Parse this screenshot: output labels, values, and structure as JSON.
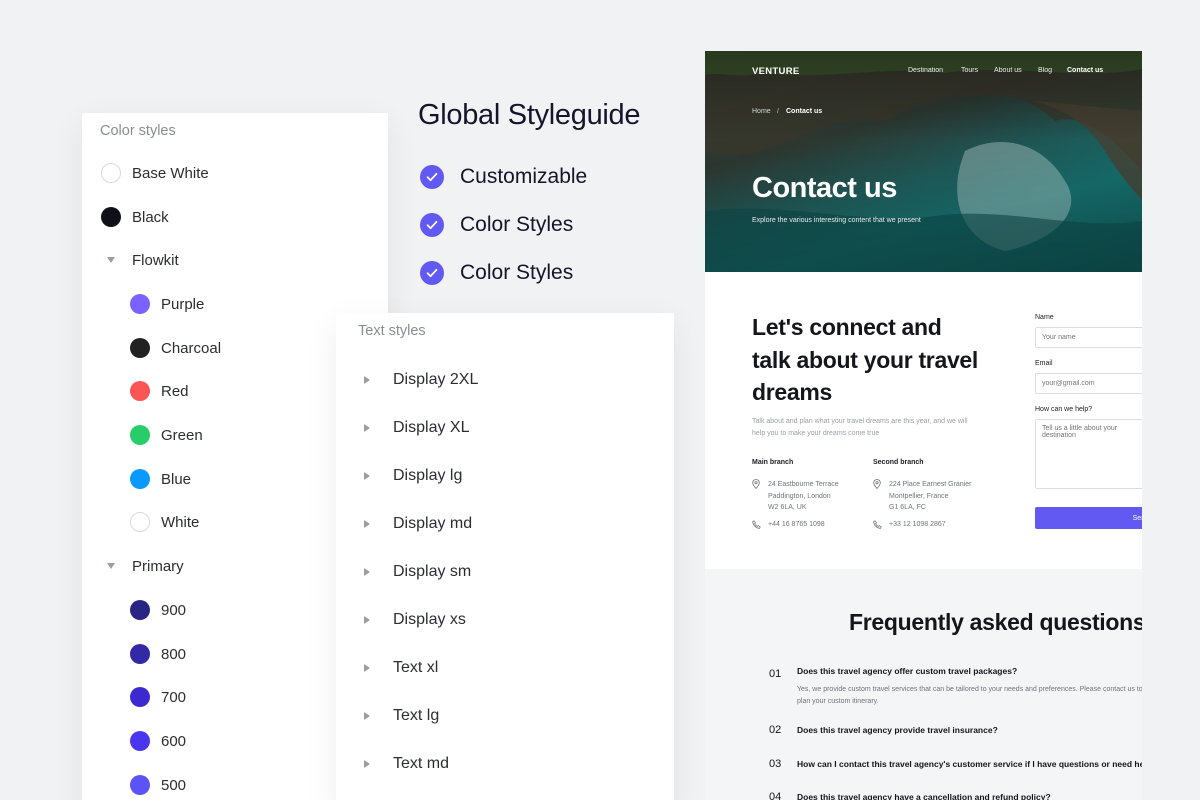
{
  "color_styles": {
    "title": "Color styles",
    "items": [
      {
        "label": "Base White",
        "color": "#ffffff",
        "bordered": true
      },
      {
        "label": "Black",
        "color": "#0f1119"
      }
    ],
    "groups": [
      {
        "label": "Flowkit",
        "items": [
          {
            "label": "Purple",
            "color": "#7b61ff"
          },
          {
            "label": "Charcoal",
            "color": "#222222"
          },
          {
            "label": "Red",
            "color": "#fc5555"
          },
          {
            "label": "Green",
            "color": "#29cc6a"
          },
          {
            "label": "Blue",
            "color": "#0999ff"
          },
          {
            "label": "White",
            "color": "#ffffff",
            "bordered": true
          }
        ]
      },
      {
        "label": "Primary",
        "items": [
          {
            "label": "900",
            "color": "#2a2585"
          },
          {
            "label": "800",
            "color": "#3328a6"
          },
          {
            "label": "700",
            "color": "#3c2ad0"
          },
          {
            "label": "600",
            "color": "#4a36ee"
          },
          {
            "label": "500",
            "color": "#5b53f5"
          }
        ]
      }
    ]
  },
  "text_styles": {
    "title": "Text styles",
    "items": [
      "Display 2XL",
      "Display XL",
      "Display lg",
      "Display md",
      "Display sm",
      "Display xs",
      "Text xl",
      "Text lg",
      "Text md"
    ]
  },
  "styleguide": {
    "title": "Global Styleguide",
    "features": [
      "Customizable",
      "Color Styles",
      "Color Styles"
    ]
  },
  "site": {
    "logo": "VENTURE",
    "nav": [
      "Destination",
      "Tours",
      "About us",
      "Blog",
      "Contact us"
    ],
    "breadcrumb": {
      "home": "Home",
      "separator": "/",
      "current": "Contact us"
    },
    "hero_title": "Contact us",
    "hero_subtitle": "Explore the various interesting content that we present",
    "contact_heading": "Let's connect and talk about your travel dreams",
    "contact_desc": "Talk about and plan what your travel dreams are this year, and we will help you to make your dreams come true",
    "branches": [
      {
        "title": "Main branch",
        "address": [
          "24 Eastbourne Terrace",
          "Paddington, London",
          "W2 6LA, UK"
        ],
        "phone": "+44 16 8765 1098"
      },
      {
        "title": "Second branch",
        "address": [
          "224 Place Earnest Granier",
          "Montpellier, France",
          "G1 6LA, FC"
        ],
        "phone": "+33 12 1098 2867"
      }
    ],
    "form": {
      "name_label": "Name",
      "name_placeholder": "Your name",
      "email_label": "Email",
      "email_placeholder": "your@gmail.com",
      "help_label": "How can we help?",
      "help_placeholder": "Tell us a little about your destination",
      "submit": "Send"
    },
    "faq": {
      "title": "Frequently asked questions",
      "items": [
        {
          "num": "01",
          "q": "Does this travel agency offer custom travel packages?",
          "a": "Yes, we provide custom travel services that can be tailored to your needs and preferences. Please contact us to plan your custom itinerary."
        },
        {
          "num": "02",
          "q": "Does this travel agency provide travel insurance?"
        },
        {
          "num": "03",
          "q": "How can I contact this travel agency's customer service if I have questions or need help?"
        },
        {
          "num": "04",
          "q": "Does this travel agency have a cancellation and refund policy?"
        }
      ]
    }
  }
}
